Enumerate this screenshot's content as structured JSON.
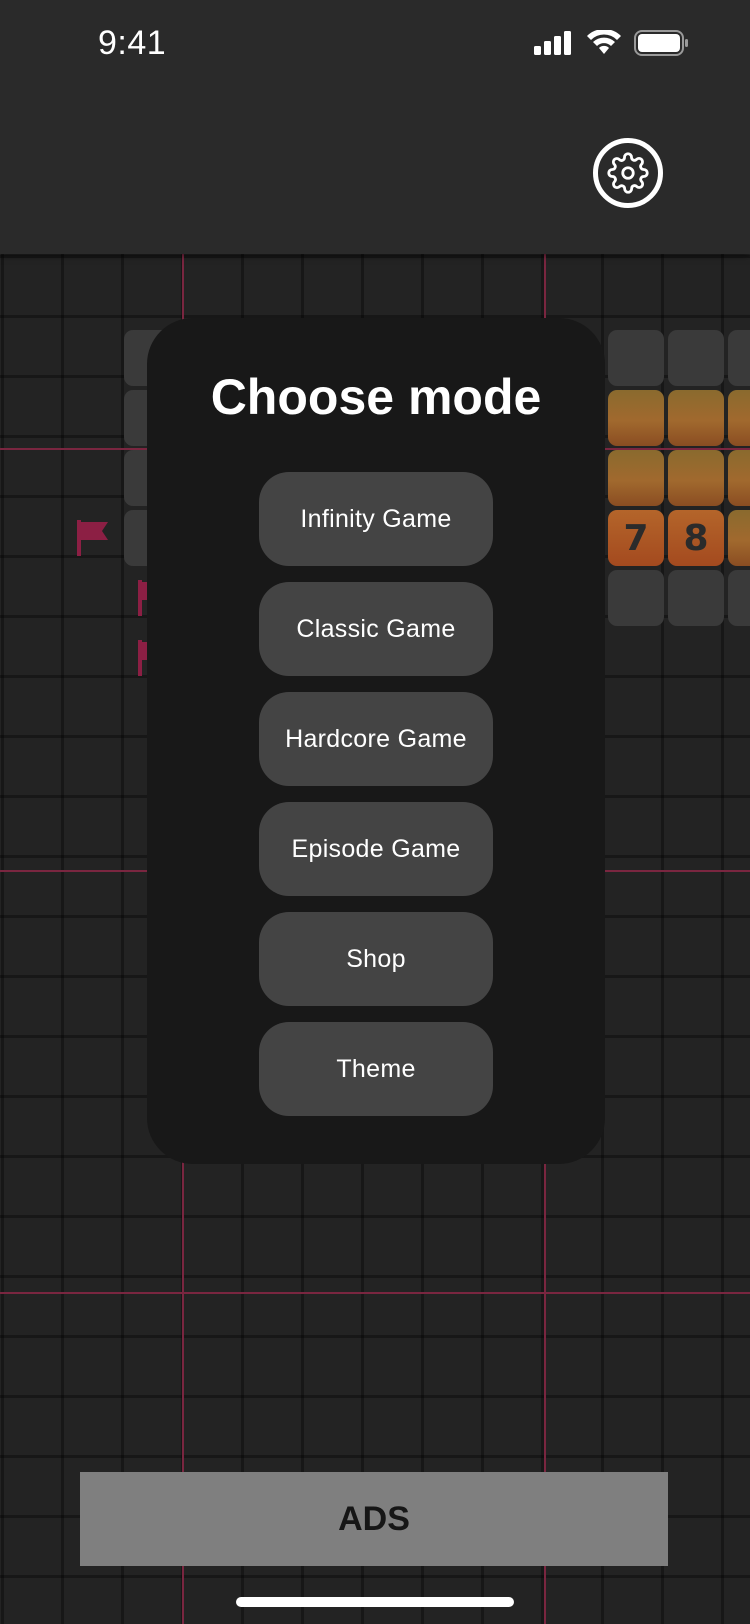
{
  "status_bar": {
    "time": "9:41",
    "icons": [
      "signal-icon",
      "wifi-icon",
      "battery-icon"
    ]
  },
  "header": {
    "settings_icon": "gear-icon"
  },
  "board": {
    "revealed_numbers": [
      "7",
      "8"
    ],
    "flag_color": "#8c1f44",
    "sector_line_color": "#7a2640",
    "hot_cell_color": "#a1692e"
  },
  "mode_panel": {
    "title": "Choose mode",
    "buttons": [
      {
        "label": "Infinity Game"
      },
      {
        "label": "Classic Game"
      },
      {
        "label": "Hardcore Game"
      },
      {
        "label": "Episode Game"
      },
      {
        "label": "Shop"
      },
      {
        "label": "Theme"
      }
    ]
  },
  "ads": {
    "label": "ADS"
  }
}
